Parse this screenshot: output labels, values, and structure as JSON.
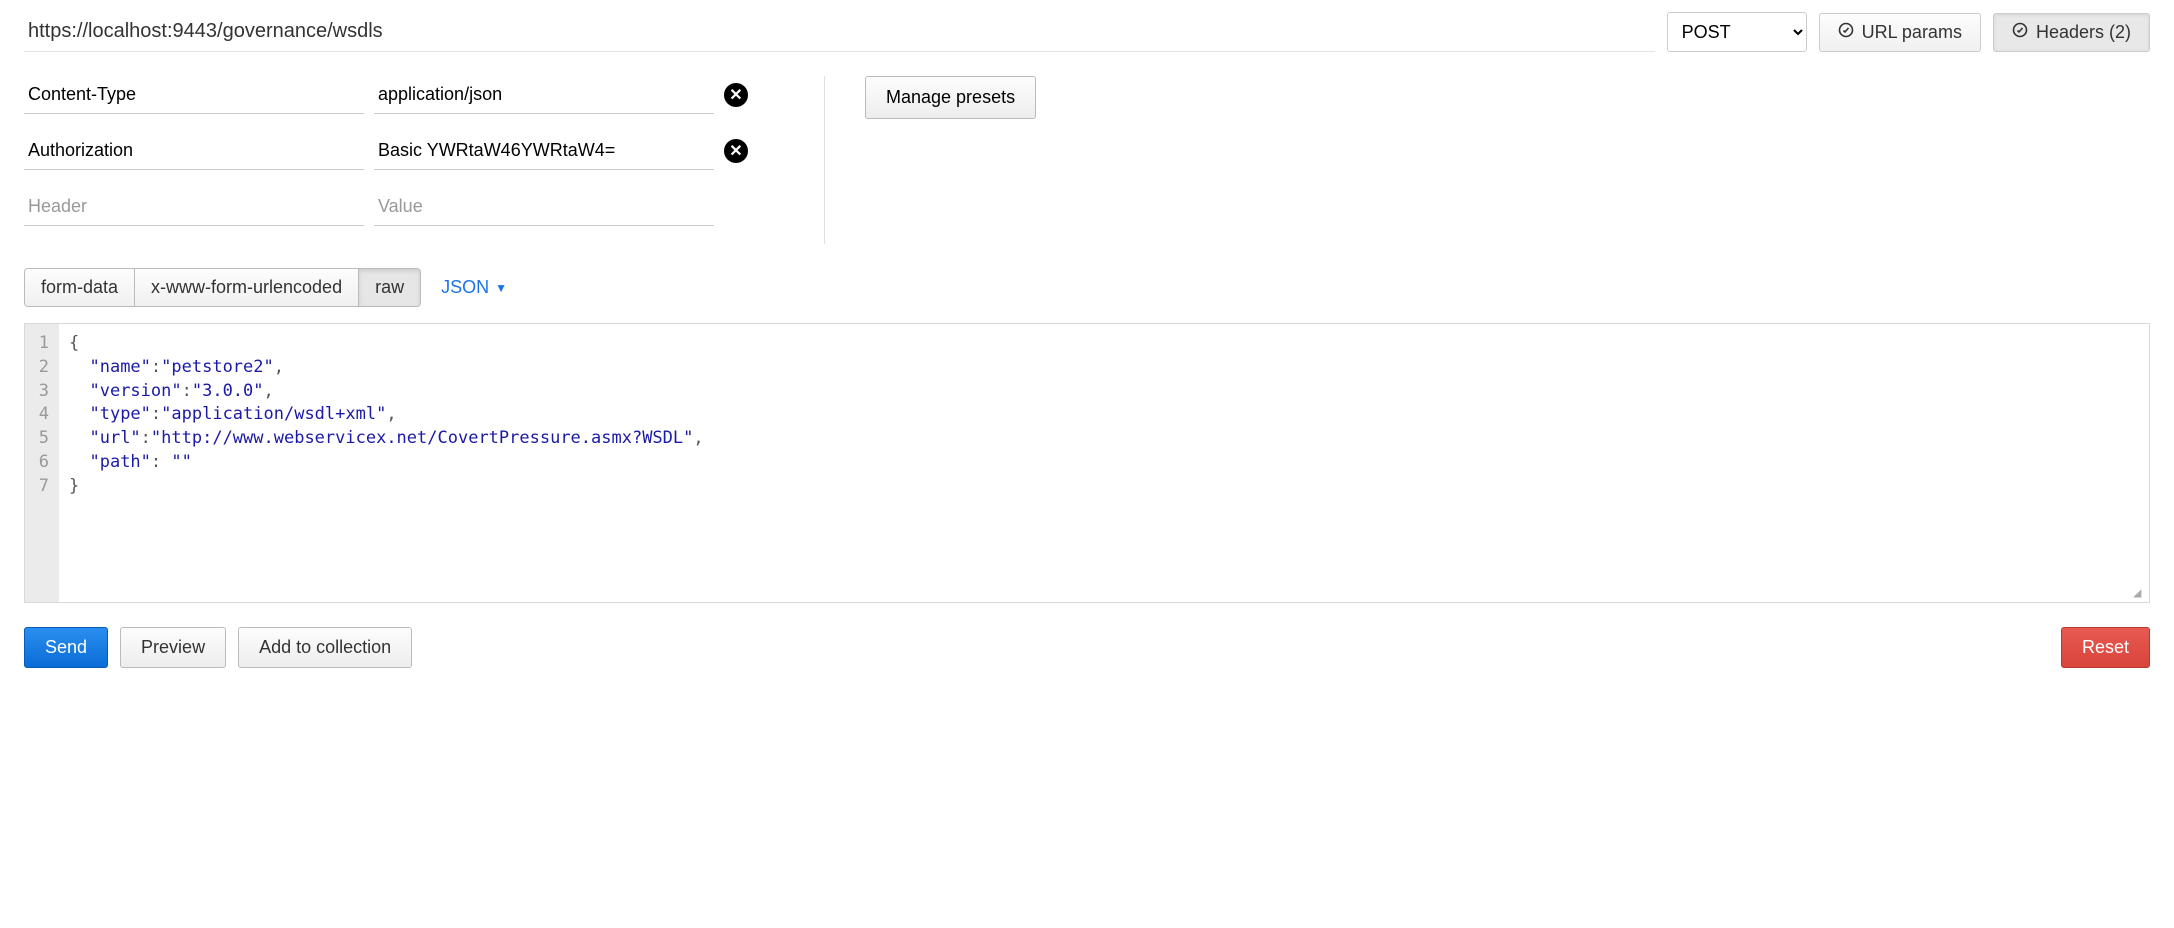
{
  "url": "https://localhost:9443/governance/wsdls",
  "method": "POST",
  "topButtons": {
    "urlParams": "URL params",
    "headers": "Headers (2)"
  },
  "headers": [
    {
      "key": "Content-Type",
      "value": "application/json"
    },
    {
      "key": "Authorization",
      "value": "Basic YWRtaW46YWRtaW4="
    }
  ],
  "newHeader": {
    "keyPlaceholder": "Header",
    "valuePlaceholder": "Value"
  },
  "managePresets": "Manage presets",
  "bodyTypes": {
    "formData": "form-data",
    "urlencoded": "x-www-form-urlencoded",
    "raw": "raw"
  },
  "formatLabel": "JSON",
  "lineNumbers": [
    "1",
    "2",
    "3",
    "4",
    "5",
    "6",
    "7"
  ],
  "body": {
    "raw": "{\n  \"name\":\"petstore2\",\n  \"version\":\"3.0.0\",\n  \"type\":\"application/wsdl+xml\",\n  \"url\":\"http://www.webservicex.net/CovertPressure.asmx?WSDL\",\n  \"path\": \"\"\n}",
    "pairs": [
      {
        "k": "name",
        "v": "petstore2"
      },
      {
        "k": "version",
        "v": "3.0.0"
      },
      {
        "k": "type",
        "v": "application/wsdl+xml"
      },
      {
        "k": "url",
        "v": "http://www.webservicex.net/CovertPressure.asmx?WSDL"
      },
      {
        "k": "path",
        "v": ""
      }
    ]
  },
  "actions": {
    "send": "Send",
    "preview": "Preview",
    "addToCollection": "Add to collection",
    "reset": "Reset"
  }
}
